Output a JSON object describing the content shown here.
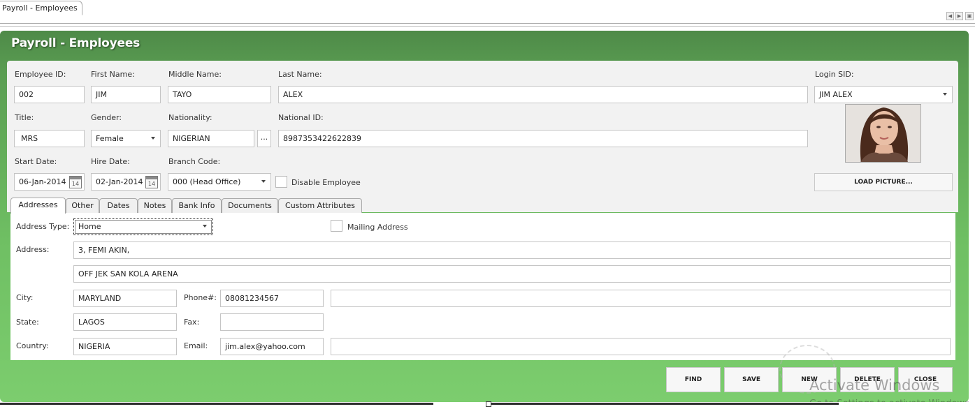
{
  "doc_tab": {
    "label": "Payroll - Employees"
  },
  "window": {
    "title": "Payroll - Employees"
  },
  "labels": {
    "employee_id": "Employee ID:",
    "first_name": "First Name:",
    "middle_name": "Middle Name:",
    "last_name": "Last Name:",
    "login_sid": "Login SID:",
    "title": "Title:",
    "gender": "Gender:",
    "nationality": "Nationality:",
    "national_id": "National ID:",
    "start_date": "Start Date:",
    "hire_date": "Hire Date:",
    "branch_code": "Branch Code:",
    "disable_employee": "Disable Employee"
  },
  "values": {
    "employee_id": "002",
    "first_name": "JIM",
    "middle_name": "TAYO",
    "last_name": "ALEX",
    "login_sid": "JIM ALEX",
    "title": "MRS",
    "gender": "Female",
    "nationality": "NIGERIAN",
    "national_id": "8987353422622839",
    "start_date": "06-Jan-2014",
    "hire_date": "02-Jan-2014",
    "branch_code": "000 (Head Office)",
    "calendar_day": "14",
    "ellipsis": "..."
  },
  "buttons": {
    "load_picture": "LOAD PICTURE...",
    "find": "FIND",
    "save": "SAVE",
    "new": "NEW",
    "delete": "DELETE",
    "close": "CLOSE"
  },
  "tabs": [
    "Addresses",
    "Other",
    "Dates",
    "Notes",
    "Bank Info",
    "Documents",
    "Custom Attributes"
  ],
  "address": {
    "address_type_label": "Address Type:",
    "address_type": "Home",
    "mailing_address_label": "Mailing Address",
    "address_label": "Address:",
    "line1": "3, FEMI AKIN,",
    "line2": "OFF JEK SAN KOLA ARENA",
    "city_label": "City:",
    "city": "MARYLAND",
    "state_label": "State:",
    "state": "LAGOS",
    "country_label": "Country:",
    "country": "NIGERIA",
    "phone_label": "Phone#:",
    "phone": "08081234567",
    "phone_ext": "",
    "fax_label": "Fax:",
    "fax": "",
    "email_label": "Email:",
    "email": "jim.alex@yahoo.com",
    "email_ext": ""
  },
  "watermark": {
    "line1": "Activate Windows",
    "line2": "Go to Settings to activate Windows."
  },
  "colors": {
    "panel_green_top": "#4e8a48",
    "panel_green_bottom": "#7ccd6e",
    "card_bg": "#f2f2f2"
  }
}
